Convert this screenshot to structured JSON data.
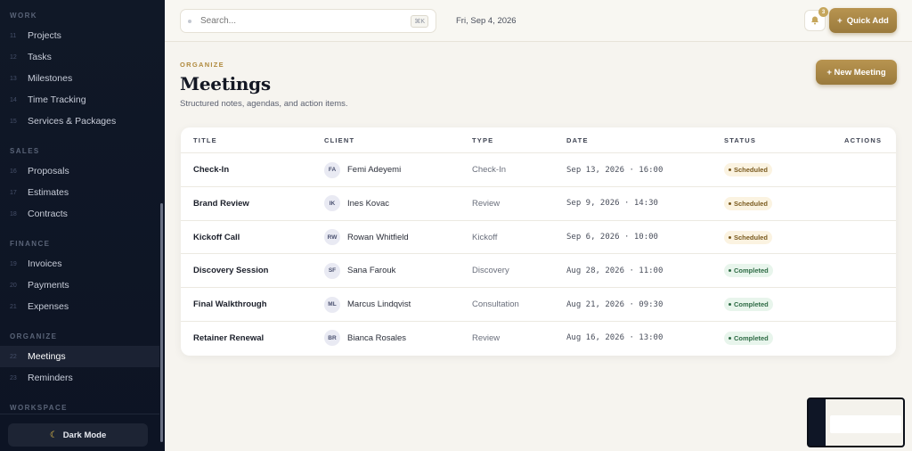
{
  "sidebar": {
    "sections": [
      {
        "label": "WORK",
        "items": [
          {
            "num": "11",
            "label": "Projects"
          },
          {
            "num": "12",
            "label": "Tasks"
          },
          {
            "num": "13",
            "label": "Milestones"
          },
          {
            "num": "14",
            "label": "Time Tracking"
          },
          {
            "num": "15",
            "label": "Services & Packages"
          }
        ]
      },
      {
        "label": "SALES",
        "items": [
          {
            "num": "16",
            "label": "Proposals"
          },
          {
            "num": "17",
            "label": "Estimates"
          },
          {
            "num": "18",
            "label": "Contracts"
          }
        ]
      },
      {
        "label": "FINANCE",
        "items": [
          {
            "num": "19",
            "label": "Invoices"
          },
          {
            "num": "20",
            "label": "Payments"
          },
          {
            "num": "21",
            "label": "Expenses"
          }
        ]
      },
      {
        "label": "ORGANIZE",
        "items": [
          {
            "num": "22",
            "label": "Meetings",
            "active": true
          },
          {
            "num": "23",
            "label": "Reminders"
          }
        ]
      },
      {
        "label": "WORKSPACE",
        "items": []
      }
    ],
    "dark_mode_label": "Dark Mode"
  },
  "topbar": {
    "search_placeholder": "Search...",
    "search_shortcut": "⌘K",
    "date": "Fri, Sep 4, 2026",
    "notification_count": "3",
    "quick_add_label": "Quick Add"
  },
  "page": {
    "eyebrow": "ORGANIZE",
    "title": "Meetings",
    "subtitle": "Structured notes, agendas, and action items.",
    "new_button": "+ New Meeting"
  },
  "table": {
    "headers": {
      "title": "TITLE",
      "client": "CLIENT",
      "type": "TYPE",
      "date": "DATE",
      "status": "STATUS",
      "actions": "ACTIONS"
    },
    "rows": [
      {
        "title": "Check-In",
        "initials": "FA",
        "client": "Femi Adeyemi",
        "type": "Check-In",
        "date": "Sep 13, 2026 · 16:00",
        "status": "Scheduled"
      },
      {
        "title": "Brand Review",
        "initials": "IK",
        "client": "Ines Kovac",
        "type": "Review",
        "date": "Sep 9, 2026 · 14:30",
        "status": "Scheduled"
      },
      {
        "title": "Kickoff Call",
        "initials": "RW",
        "client": "Rowan Whitfield",
        "type": "Kickoff",
        "date": "Sep 6, 2026 · 10:00",
        "status": "Scheduled"
      },
      {
        "title": "Discovery Session",
        "initials": "SF",
        "client": "Sana Farouk",
        "type": "Discovery",
        "date": "Aug 28, 2026 · 11:00",
        "status": "Completed"
      },
      {
        "title": "Final Walkthrough",
        "initials": "ML",
        "client": "Marcus Lindqvist",
        "type": "Consultation",
        "date": "Aug 21, 2026 · 09:30",
        "status": "Completed"
      },
      {
        "title": "Retainer Renewal",
        "initials": "BR",
        "client": "Bianca Rosales",
        "type": "Review",
        "date": "Aug 16, 2026 · 13:00",
        "status": "Completed"
      }
    ]
  },
  "colors": {
    "accent": "#b08a3e",
    "sidebar_bg": "#101827",
    "scheduled_bg": "#fbf3e1",
    "scheduled_text": "#7a5a1e",
    "completed_bg": "#e8f5ec",
    "completed_text": "#2e6b45"
  }
}
